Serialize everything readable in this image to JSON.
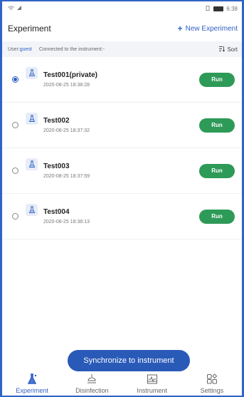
{
  "status_bar": {
    "time": "6:38"
  },
  "header": {
    "title": "Experiment",
    "new_label": "New Experiment"
  },
  "subbar": {
    "user_label": "User:",
    "user_value": "guest",
    "connection": "Connected to the instrument:-",
    "sort_label": "Sort"
  },
  "experiments": [
    {
      "name": "Test001(private)",
      "date": "2020-08-25 18:38:28",
      "selected": true,
      "action": "Run"
    },
    {
      "name": "Test002",
      "date": "2020-08-25 18:37:32",
      "selected": false,
      "action": "Run"
    },
    {
      "name": "Test003",
      "date": "2020-08-25 18:37:59",
      "selected": false,
      "action": "Run"
    },
    {
      "name": "Test004",
      "date": "2020-08-25 18:38:13",
      "selected": false,
      "action": "Run"
    }
  ],
  "sync_button": "Synchronize to instrument",
  "nav": {
    "items": [
      {
        "label": "Experiment",
        "icon": "experiment-icon",
        "active": true
      },
      {
        "label": "Disinfection",
        "icon": "disinfection-icon",
        "active": false
      },
      {
        "label": "Instrument",
        "icon": "instrument-icon",
        "active": false
      },
      {
        "label": "Settings",
        "icon": "settings-icon",
        "active": false
      }
    ]
  },
  "colors": {
    "accent": "#2f5fc4",
    "run": "#2e9a57",
    "sync": "#2a5ab8"
  }
}
